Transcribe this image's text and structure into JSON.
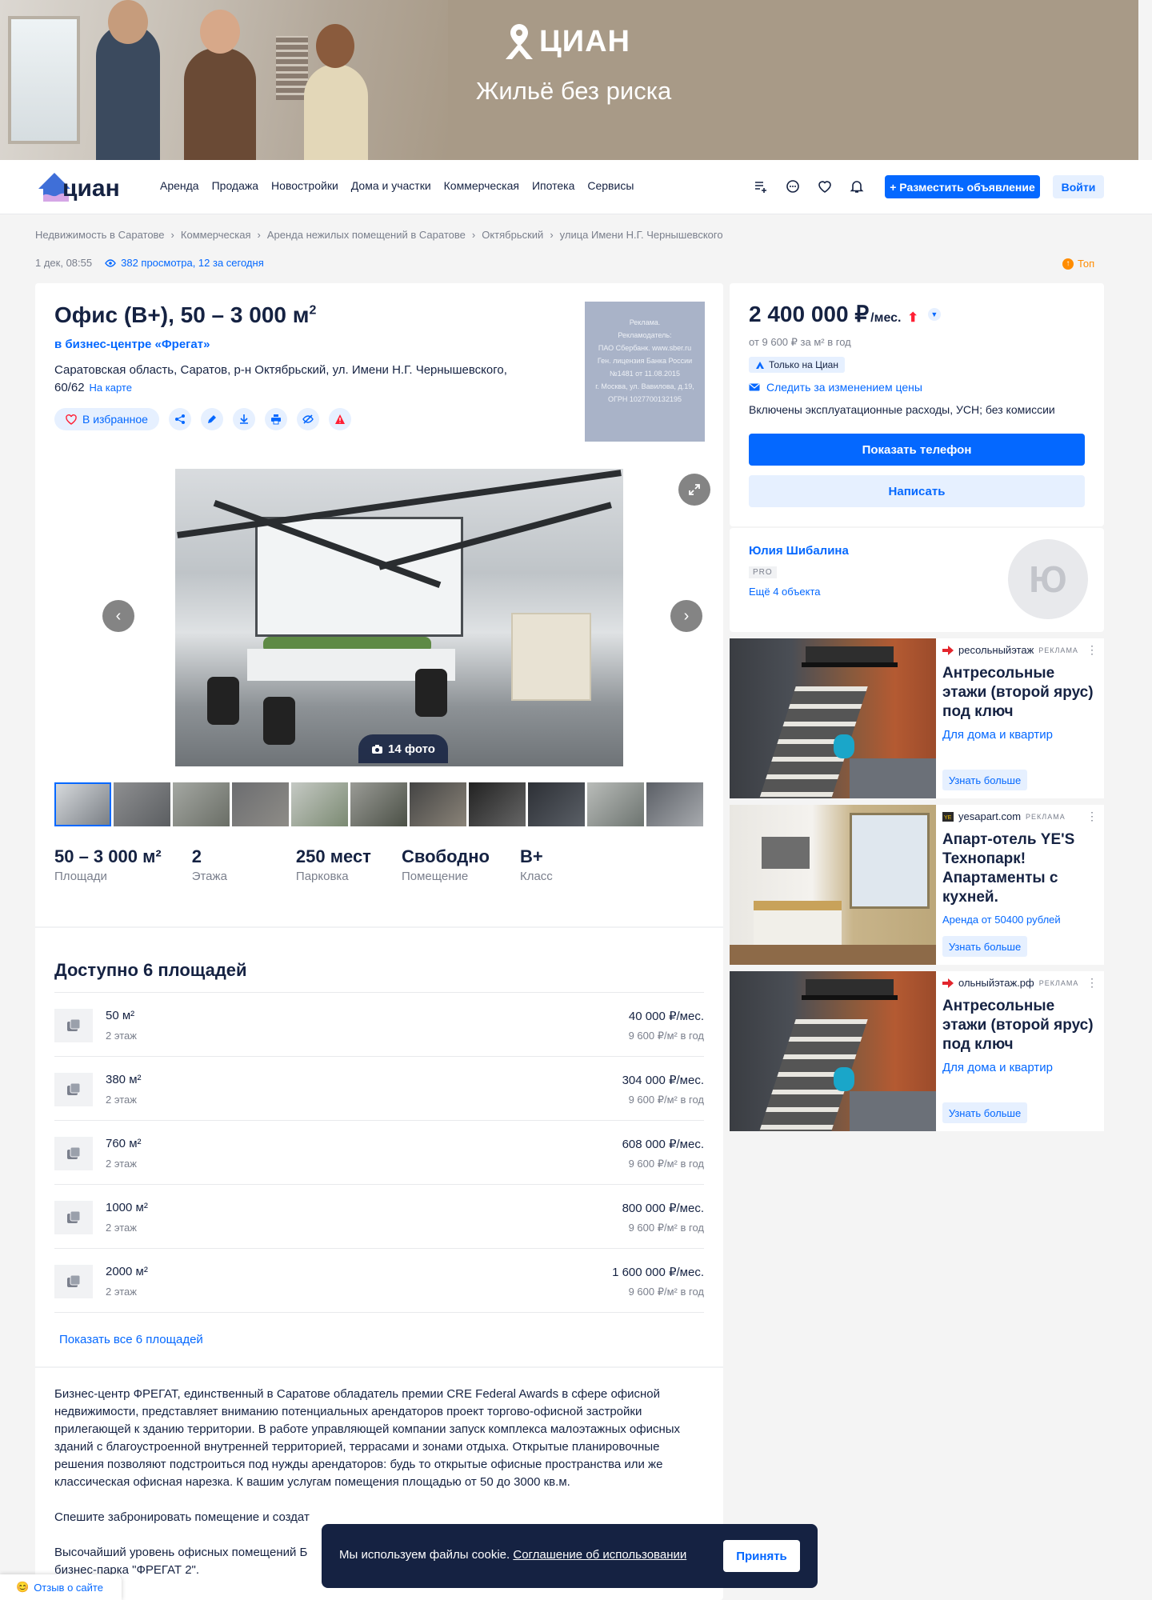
{
  "banner": {
    "brand": "ЦИАН",
    "slogan": "Жильё без риска"
  },
  "header": {
    "logo_text": "циан",
    "nav": [
      "Аренда",
      "Продажа",
      "Новостройки",
      "Дома и участки",
      "Коммерческая",
      "Ипотека",
      "Сервисы"
    ],
    "post_button": "+ Разместить объявление",
    "login_button": "Войти",
    "icons": [
      "compare-icon",
      "chat-icon",
      "heart-icon",
      "bell-icon"
    ]
  },
  "breadcrumbs": [
    "Недвижимость в Саратове",
    "Коммерческая",
    "Аренда нежилых помещений в Саратове",
    "Октябрьский",
    "улица Имени Н.Г. Чернышевского"
  ],
  "meta": {
    "date": "1 дек, 08:55",
    "views": "382 просмотра, 12 за сегодня",
    "top_label": "Топ"
  },
  "listing": {
    "title": "Офис (B+), 50 – 3 000 м",
    "title_sup": "2",
    "business_center": "в бизнес-центре «Фрегат»",
    "address": "Саратовская область, Саратов, р-н Октябрьский, ул. Имени Н.Г. Чернышевского, 60/62",
    "map_link": "На карте",
    "favorite_button": "В избранное",
    "photo_count": "14 фото",
    "ad_notice": [
      "Реклама.",
      "Рекламодатель:",
      "ПАО Сбербанк. www.sber.ru",
      "Ген. лицензия Банка России",
      "№1481 от 11.08.2015",
      "г. Москва, ул. Вавилова, д.19,",
      "ОГРН 1027700132195"
    ]
  },
  "facts": [
    {
      "value": "50 – 3 000 м²",
      "label": "Площади"
    },
    {
      "value": "2",
      "label": "Этажа"
    },
    {
      "value": "250 мест",
      "label": "Парковка"
    },
    {
      "value": "Свободно",
      "label": "Помещение"
    },
    {
      "value": "B+",
      "label": "Класс"
    }
  ],
  "areas": {
    "title": "Доступно 6 площадей",
    "items": [
      {
        "size": "50 м²",
        "floor": "2 этаж",
        "price": "40 000 ₽/мес.",
        "per_m2": "9 600 ₽/м² в год"
      },
      {
        "size": "380 м²",
        "floor": "2 этаж",
        "price": "304 000 ₽/мес.",
        "per_m2": "9 600 ₽/м² в год"
      },
      {
        "size": "760 м²",
        "floor": "2 этаж",
        "price": "608 000 ₽/мес.",
        "per_m2": "9 600 ₽/м² в год"
      },
      {
        "size": "1000 м²",
        "floor": "2 этаж",
        "price": "800 000 ₽/мес.",
        "per_m2": "9 600 ₽/м² в год"
      },
      {
        "size": "2000 м²",
        "floor": "2 этаж",
        "price": "1 600 000 ₽/мес.",
        "per_m2": "9 600 ₽/м² в год"
      }
    ],
    "show_all": "Показать все 6 площадей"
  },
  "description": [
    "Бизнес-центр ФРЕГАТ, единственный в Саратове обладатель премии CRE Federal Awards в сфере офисной недвижимости, представляет вниманию потенциальных арендаторов проект торгово-офисной застройки прилегающей к зданию территории. В работе управляющей компании запуск комплекса малоэтажных офисных зданий с благоустроенной внутренней территорией, террасами и зонами отдыха. Открытые планировочные решения позволяют подстроиться под нужды арендаторов: будь то открытые офисные пространства или же классическая офисная нарезка. К вашим услугам помещения площадью от 50 до 3000 кв.м.",
    "Спешите забронировать помещение и создат",
    "Высочайший уровень офисных помещений Б",
    "бизнес-парка \"ФРЕГАТ 2\"."
  ],
  "price_card": {
    "price": "2 400 000 ₽",
    "unit": "/мес.",
    "per_m2": "от 9 600 ₽ за м² в год",
    "only_cian": "Только на Циан",
    "follow": "Следить за изменением цены",
    "conditions": "Включены эксплуатационные расходы, УСН; без комиссии",
    "phone_button": "Показать телефон",
    "write_button": "Написать"
  },
  "agent": {
    "name": "Юлия Шибалина",
    "badge": "PRO",
    "more": "Ещё 4 объекта",
    "initial": "Ю"
  },
  "ads": [
    {
      "source": "ресольныйэтаж",
      "tag": "РЕКЛАМА",
      "title": "Антресольные этажи (второй ярус) под ключ",
      "subtitle": "Для дома и квартир",
      "button": "Узнать больше"
    },
    {
      "source": "yesapart.com",
      "tag": "РЕКЛАМА",
      "title": "Апарт-отель YE'S Технопарк! Апартаменты с кухней.",
      "subtitle": "Аренда от 50400 рублей",
      "button": "Узнать больше"
    },
    {
      "source": "ольныйэтаж.рф",
      "tag": "РЕКЛАМА",
      "title": "Антресольные этажи (второй ярус) под ключ",
      "subtitle": "Для дома и квартир",
      "button": "Узнать больше"
    }
  ],
  "cookie": {
    "text": "Мы используем файлы cookie.",
    "link": "Соглашение об использовании",
    "button": "Принять"
  },
  "feedback": "Отзыв о сайте",
  "colors": {
    "accent": "#0468ff",
    "text": "#152242",
    "muted": "#7a7f8c",
    "price_up": "#ff1f34",
    "top": "#ff8c00"
  }
}
